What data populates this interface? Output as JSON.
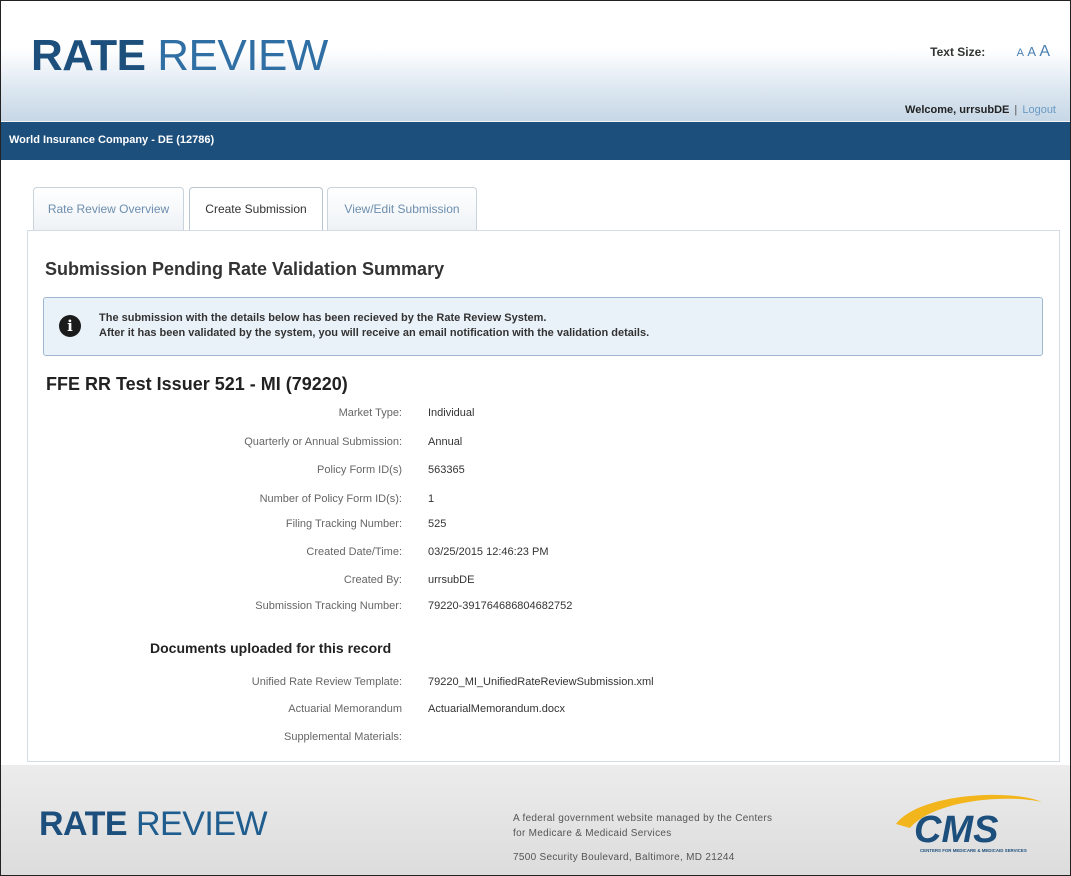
{
  "header": {
    "logo_bold": "RATE",
    "logo_light": "REVIEW",
    "text_size_label": "Text Size:",
    "text_size_options": [
      "A",
      "A",
      "A"
    ],
    "welcome_text": "Welcome, urrsubDE",
    "separator": "|",
    "logout_label": "Logout"
  },
  "company_bar": {
    "name": "World Insurance Company - DE (12786)"
  },
  "tabs": [
    {
      "label": "Rate Review Overview",
      "active": false
    },
    {
      "label": "Create Submission",
      "active": true
    },
    {
      "label": "View/Edit Submission",
      "active": false
    }
  ],
  "main": {
    "title": "Submission Pending Rate Validation Summary",
    "info_icon": "info-icon",
    "info_line1": "The submission with the details below has been recieved by the Rate Review System.",
    "info_line2": "After it has been validated by the system, you will receive an email notification with the validation details.",
    "issuer": "FFE RR Test Issuer 521 - MI (79220)",
    "details": [
      {
        "label": "Market Type:",
        "value": "Individual"
      },
      {
        "label": "Quarterly or Annual Submission:",
        "value": "Annual"
      },
      {
        "label": "Policy Form ID(s)",
        "value": "563365"
      },
      {
        "label": "Number of Policy Form ID(s):",
        "value": "1"
      },
      {
        "label": "Filing Tracking Number:",
        "value": "525"
      },
      {
        "label": "Created Date/Time:",
        "value": "03/25/2015 12:46:23 PM"
      },
      {
        "label": "Created By:",
        "value": "urrsubDE"
      },
      {
        "label": "Submission Tracking Number:",
        "value": "79220-391764686804682752"
      }
    ],
    "documents_title": "Documents uploaded for this record",
    "documents": [
      {
        "label": "Unified Rate Review Template:",
        "value": "79220_MI_UnifiedRateReviewSubmission.xml"
      },
      {
        "label": "Actuarial Memorandum",
        "value": "ActuarialMemorandum.docx"
      },
      {
        "label": "Supplemental Materials:",
        "value": ""
      }
    ]
  },
  "footer": {
    "logo_bold": "RATE",
    "logo_light": "REVIEW",
    "line1": "A federal government website managed by the Centers",
    "line2": "for Medicare & Medicaid Services",
    "address": "7500 Security Boulevard, Baltimore, MD 21244",
    "cms_logo_text": "CMS",
    "cms_logo_subtext": "CENTERS FOR MEDICARE & MEDICAID SERVICES"
  },
  "colors": {
    "brand_dark": "#1d4f7c",
    "brand_link": "#6a9ac4",
    "info_bg": "#eaf2f9"
  }
}
